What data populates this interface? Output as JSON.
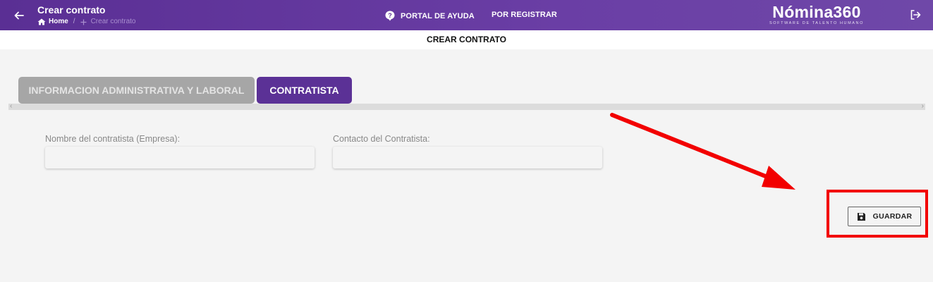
{
  "header": {
    "title": "Crear contrato",
    "breadcrumb": {
      "home": "Home",
      "current": "Crear contrato"
    },
    "nav": {
      "help": "PORTAL DE AYUDA",
      "register": "POR REGISTRAR"
    },
    "logo": {
      "name": "Nómina360",
      "tagline": "SOFTWARE DE TALENTO HUMANO"
    },
    "icons": {
      "back": "arrow-left-icon",
      "home": "home-icon",
      "breadcrumb_current": "plus-icon",
      "help": "help-badge-icon",
      "logout": "logout-icon"
    }
  },
  "subheader": {
    "title": "CREAR CONTRATO"
  },
  "tabs": [
    {
      "label": "INFORMACION ADMINISTRATIVA Y LABORAL",
      "active": false
    },
    {
      "label": "CONTRATISTA",
      "active": true
    }
  ],
  "form": {
    "contractor_name": {
      "label": "Nombre del contratista (Empresa):",
      "value": ""
    },
    "contractor_contact": {
      "label": "Contacto del Contratista:",
      "value": ""
    }
  },
  "actions": {
    "save": {
      "label": "GUARDAR",
      "icon": "floppy-disk-icon"
    }
  },
  "colors": {
    "header_bg": "#5a2f94",
    "tab_active": "#5b3196",
    "tab_inactive": "#a6a6a6",
    "annotation": "#f20000"
  }
}
